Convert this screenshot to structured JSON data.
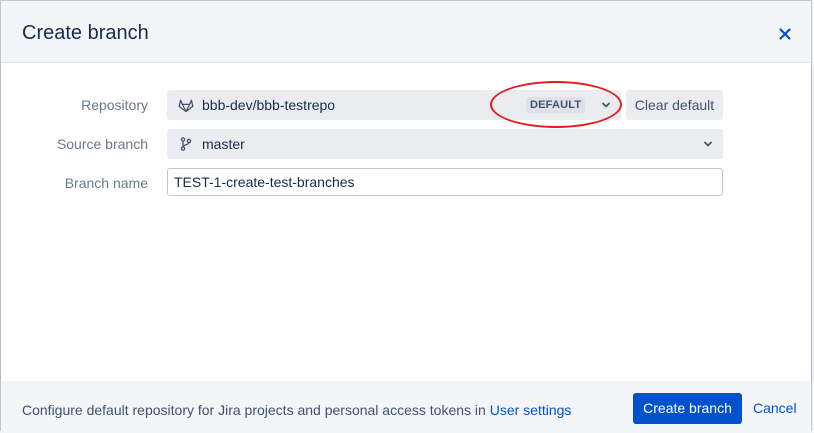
{
  "dialog": {
    "title": "Create branch",
    "close_icon": "close-icon"
  },
  "form": {
    "repository": {
      "label": "Repository",
      "value": "bbb-dev/bbb-testrepo",
      "icon": "gitlab-icon",
      "badge": "DEFAULT",
      "clear_label": "Clear default"
    },
    "source_branch": {
      "label": "Source branch",
      "value": "master",
      "icon": "branch-icon"
    },
    "branch_name": {
      "label": "Branch name",
      "value": "TEST-1-create-test-branches"
    }
  },
  "footer": {
    "text": "Configure default repository for Jira projects and personal access tokens in",
    "link": "User settings",
    "create_label": "Create branch",
    "cancel_label": "Cancel"
  },
  "colors": {
    "primary": "#0052cc",
    "highlight": "#e01d1d",
    "gitlab": "#e24329"
  }
}
